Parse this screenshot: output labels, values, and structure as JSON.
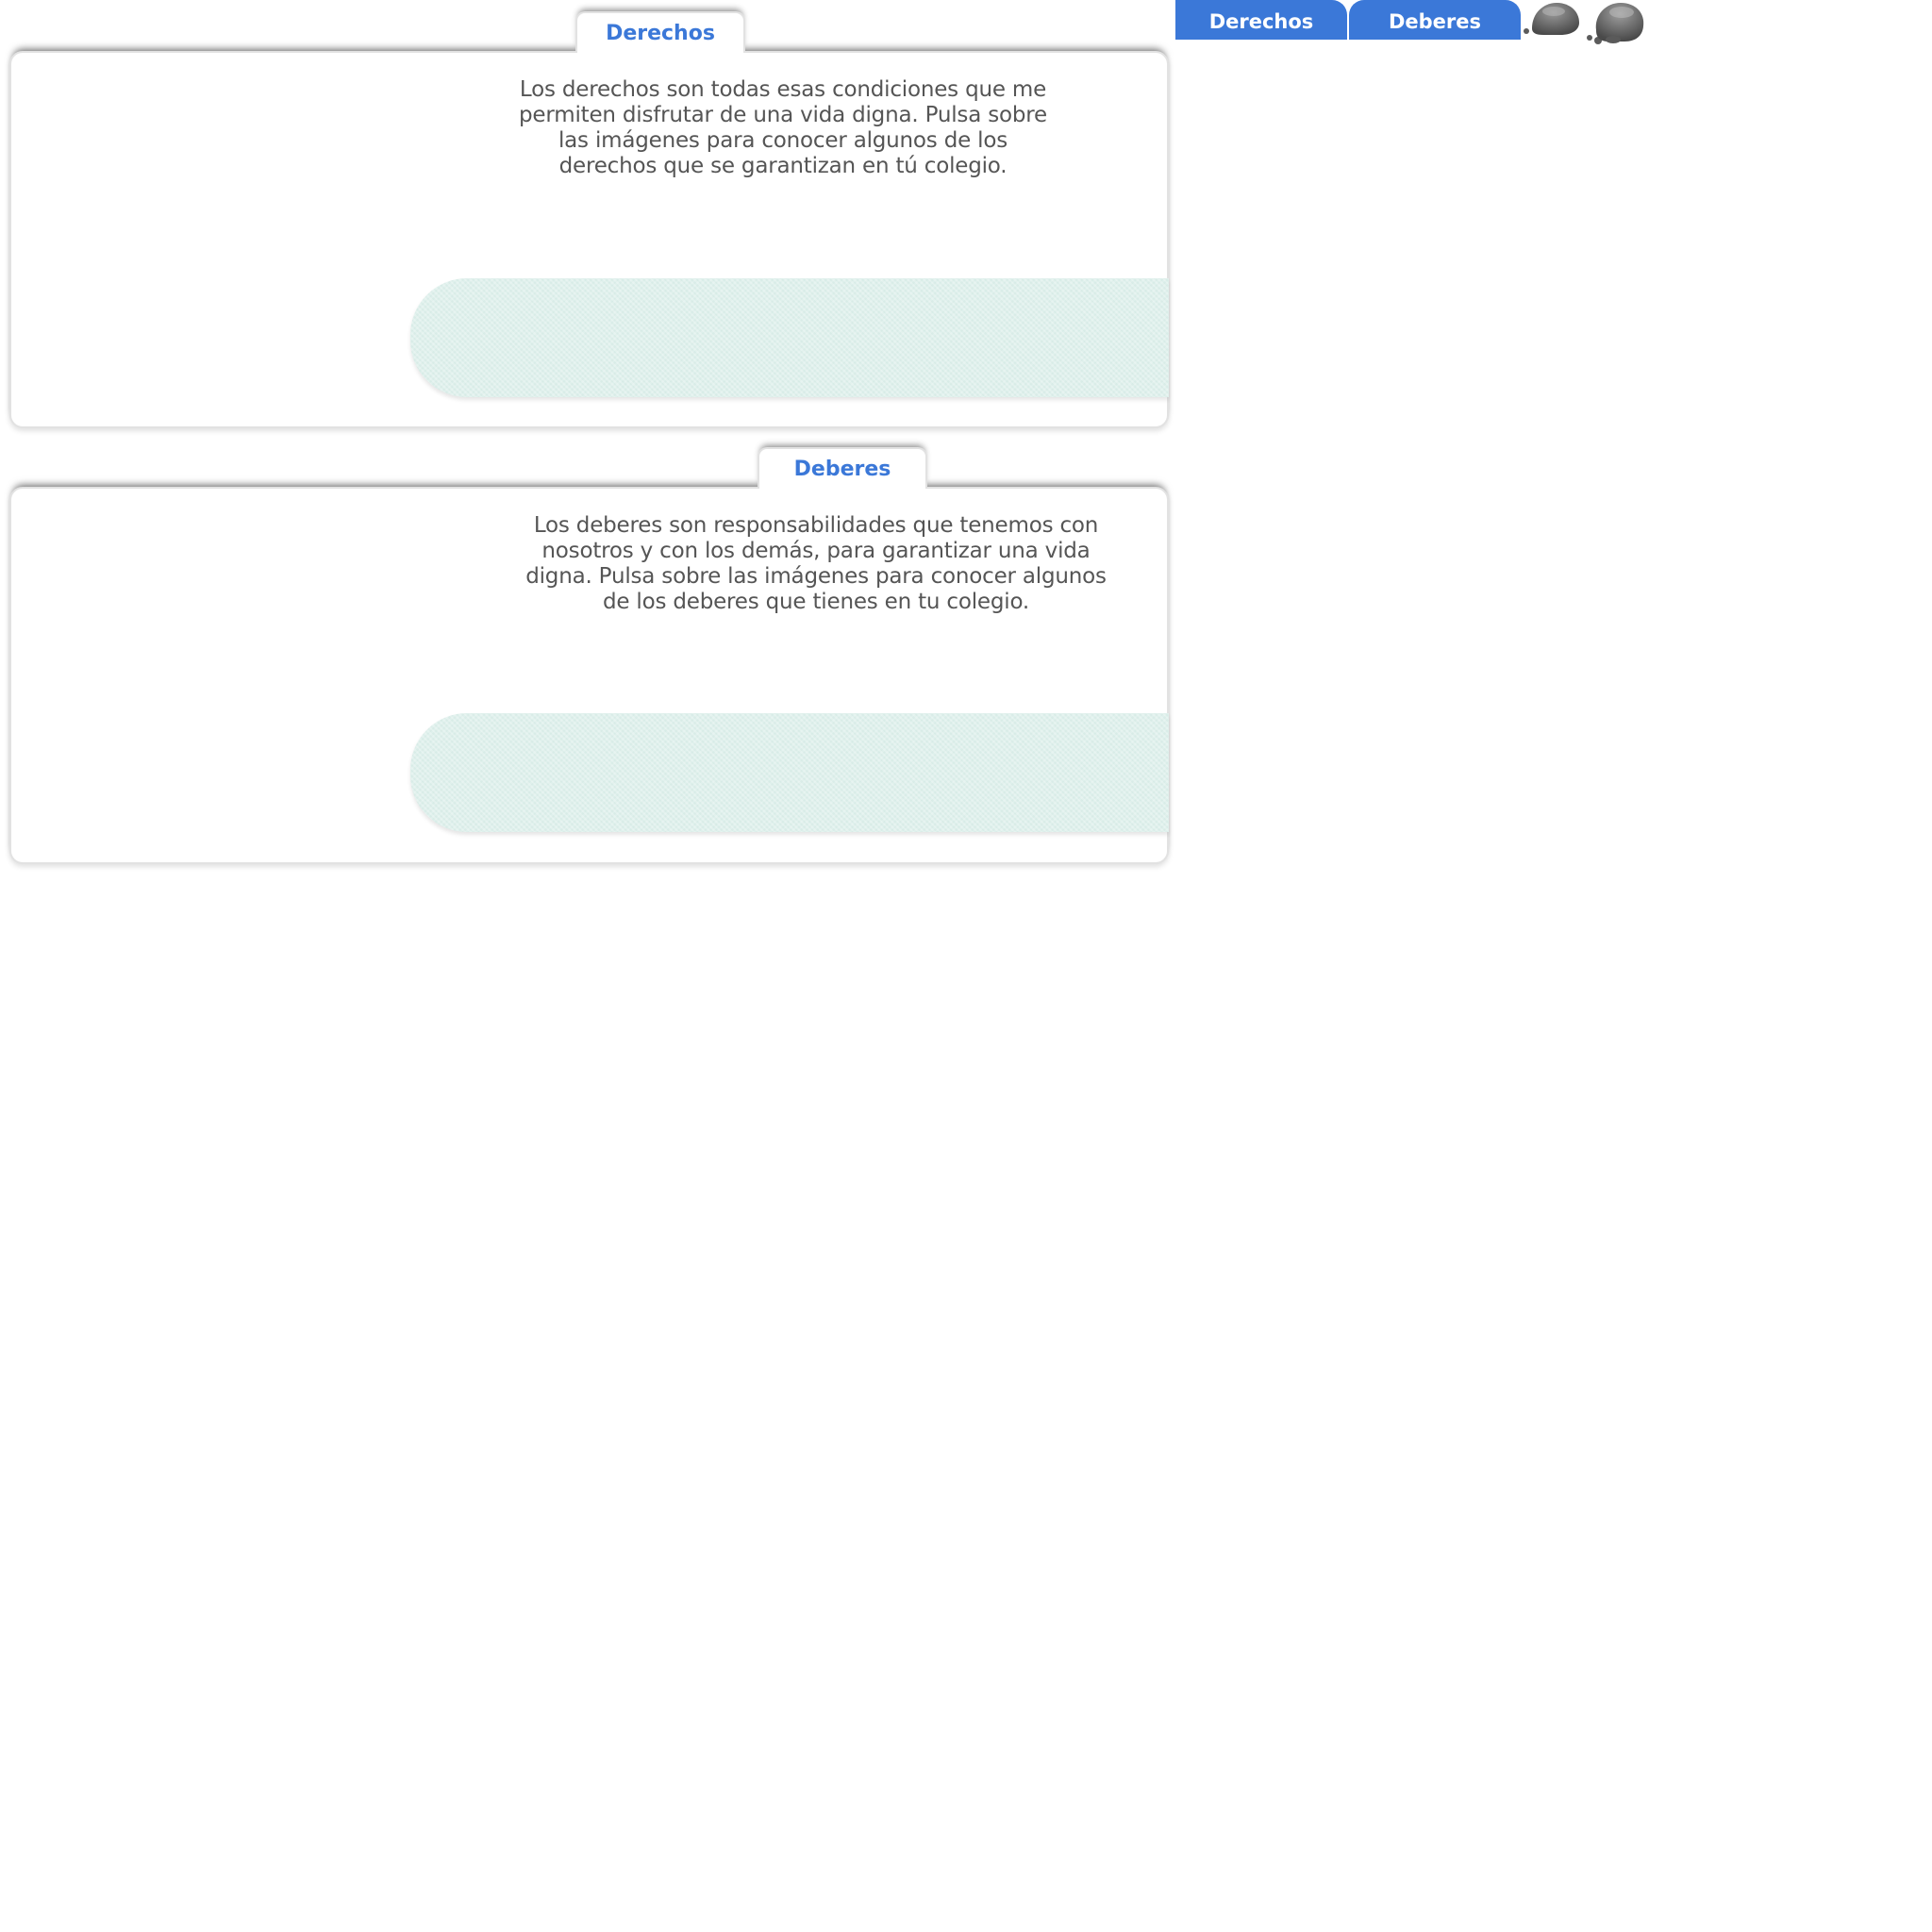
{
  "nav": {
    "tabs": [
      {
        "label": "Derechos"
      },
      {
        "label": "Deberes"
      }
    ],
    "icons": [
      "thought-bubble-icon",
      "thought-bubble-icon"
    ]
  },
  "sections": [
    {
      "tab_label": "Derechos",
      "text": "Los derechos son todas esas condiciones que me\npermiten disfrutar de una vida digna. Pulsa sobre\nlas imágenes para conocer algunos de los\nderechos que se garantizan en tú colegio."
    },
    {
      "tab_label": "Deberes",
      "text": "Los deberes son responsabilidades que tenemos con\nnosotros y con los demás, para garantizar una vida\ndigna. Pulsa sobre las imágenes para conocer algunos\nde los deberes que tienes en tu colegio."
    }
  ],
  "colors": {
    "accent": "#3b78d8",
    "text": "#555555",
    "pill": "#dff0ec",
    "icon": "#6e6e6e"
  }
}
